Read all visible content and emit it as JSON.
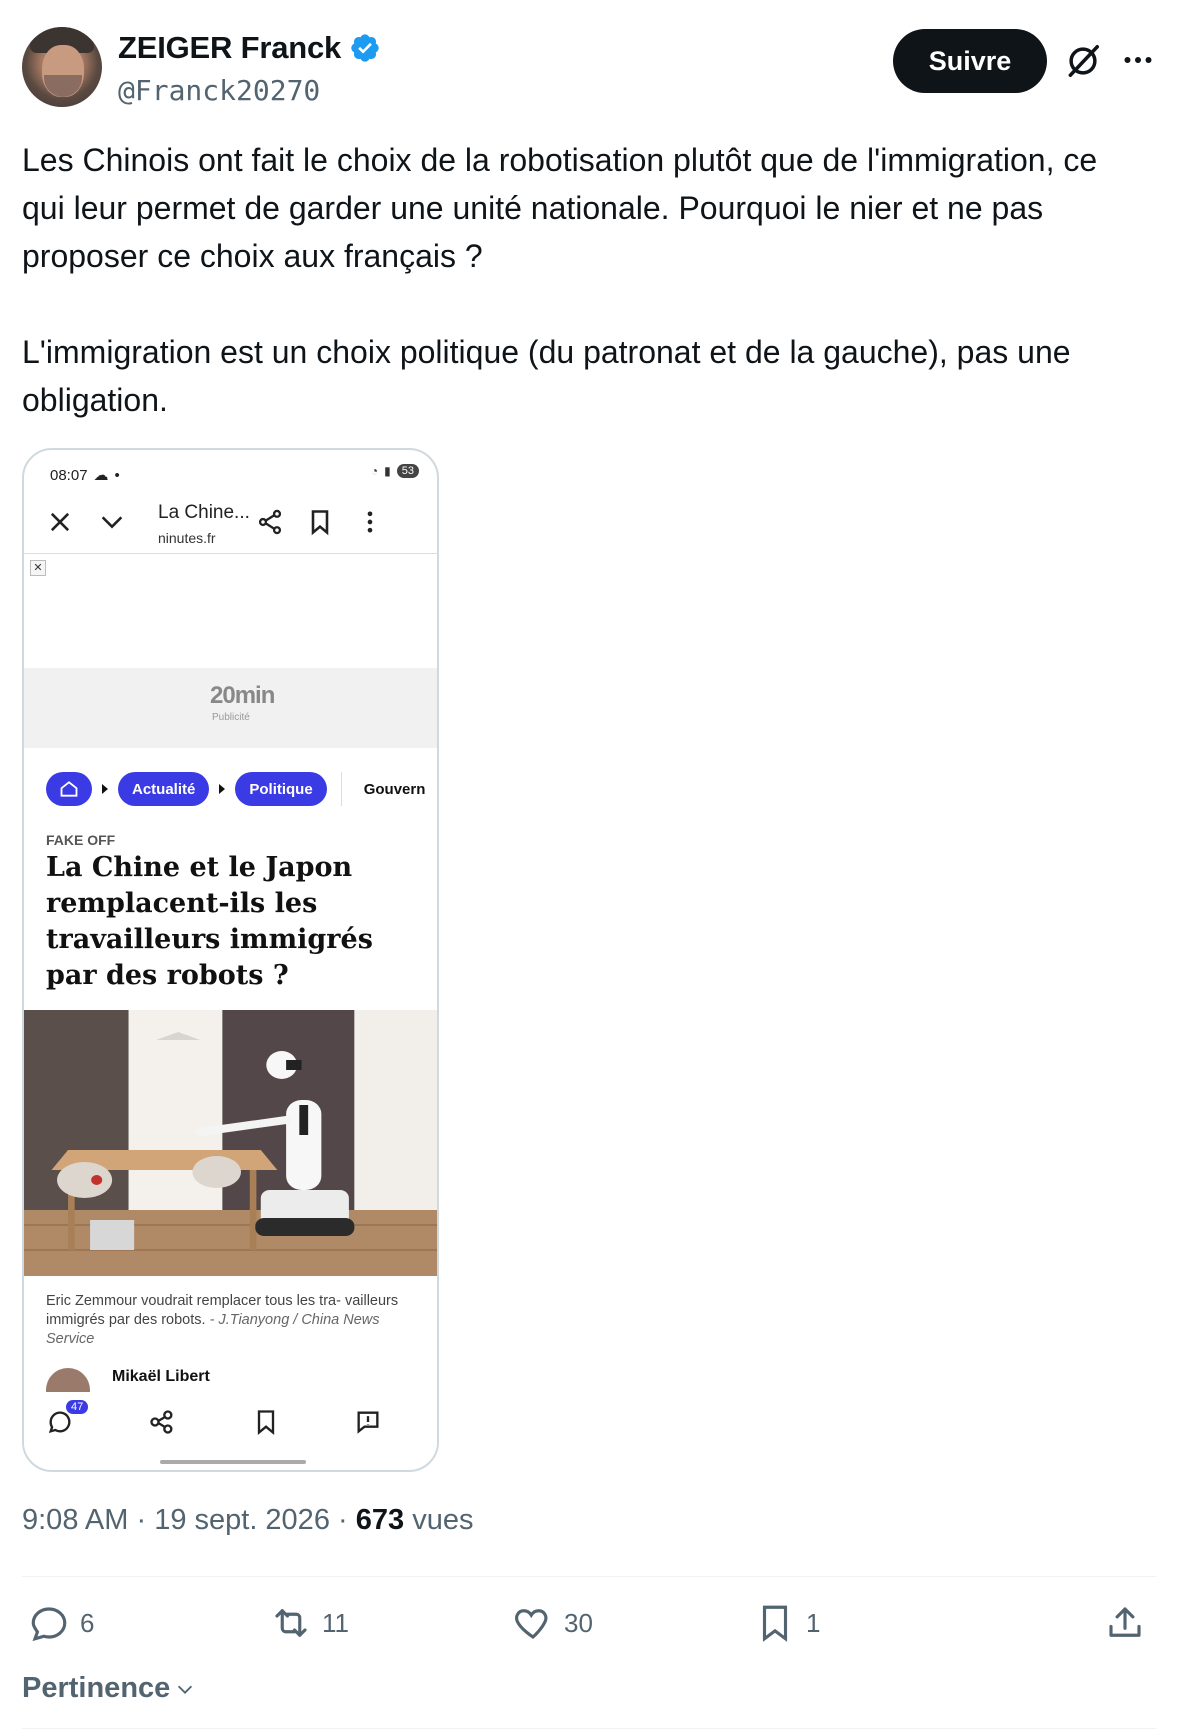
{
  "author": {
    "display_name": "ZEIGER Franck",
    "handle": "@Franck20270"
  },
  "follow_label": "Suivre",
  "tweet": {
    "paragraphs": [
      "Les Chinois ont fait le choix de la robotisation plutôt que de l'immigration, ce qui leur permet de garder une unité nationale. Pourquoi le nier et ne pas proposer ce choix aux français ?",
      "L'immigration est un choix politique (du patronat et de la gauche), pas une obligation."
    ]
  },
  "media": {
    "status_time": "08:07",
    "battery": "53",
    "tab_title": "La Chine...",
    "tab_url": "ninutes.fr",
    "ad_logo": "20min",
    "ad_label": "Publicité",
    "breadcrumbs": [
      "Actualité",
      "Politique"
    ],
    "breadcrumb_overflow": "Gouvern",
    "kicker": "FAKE OFF",
    "headline": "La Chine et le Japon remplacent-ils les travailleurs immigrés par des robots ?",
    "caption": "Eric Zemmour voudrait remplacer tous les tra- vailleurs immigrés par des robots.",
    "caption_credit": "- J.Tianyong / China News Service",
    "author_name": "Mikaël Libert",
    "comment_count": "47"
  },
  "meta": {
    "time": "9:08 AM",
    "date": "19 sept. 2026",
    "views_count": "673",
    "views_label": "vues"
  },
  "actions": {
    "replies": "6",
    "reposts": "11",
    "likes": "30",
    "bookmarks": "1"
  },
  "sort_label": "Pertinence",
  "colors": {
    "accent": "#1d9bf0",
    "text": "#0f1419",
    "muted": "#536471",
    "pill": "#3b3be6"
  },
  "icons": [
    "verified-badge-icon",
    "grok-icon",
    "more-icon",
    "reply-icon",
    "repost-icon",
    "like-icon",
    "bookmark-icon",
    "share-icon",
    "chevron-down-icon"
  ]
}
